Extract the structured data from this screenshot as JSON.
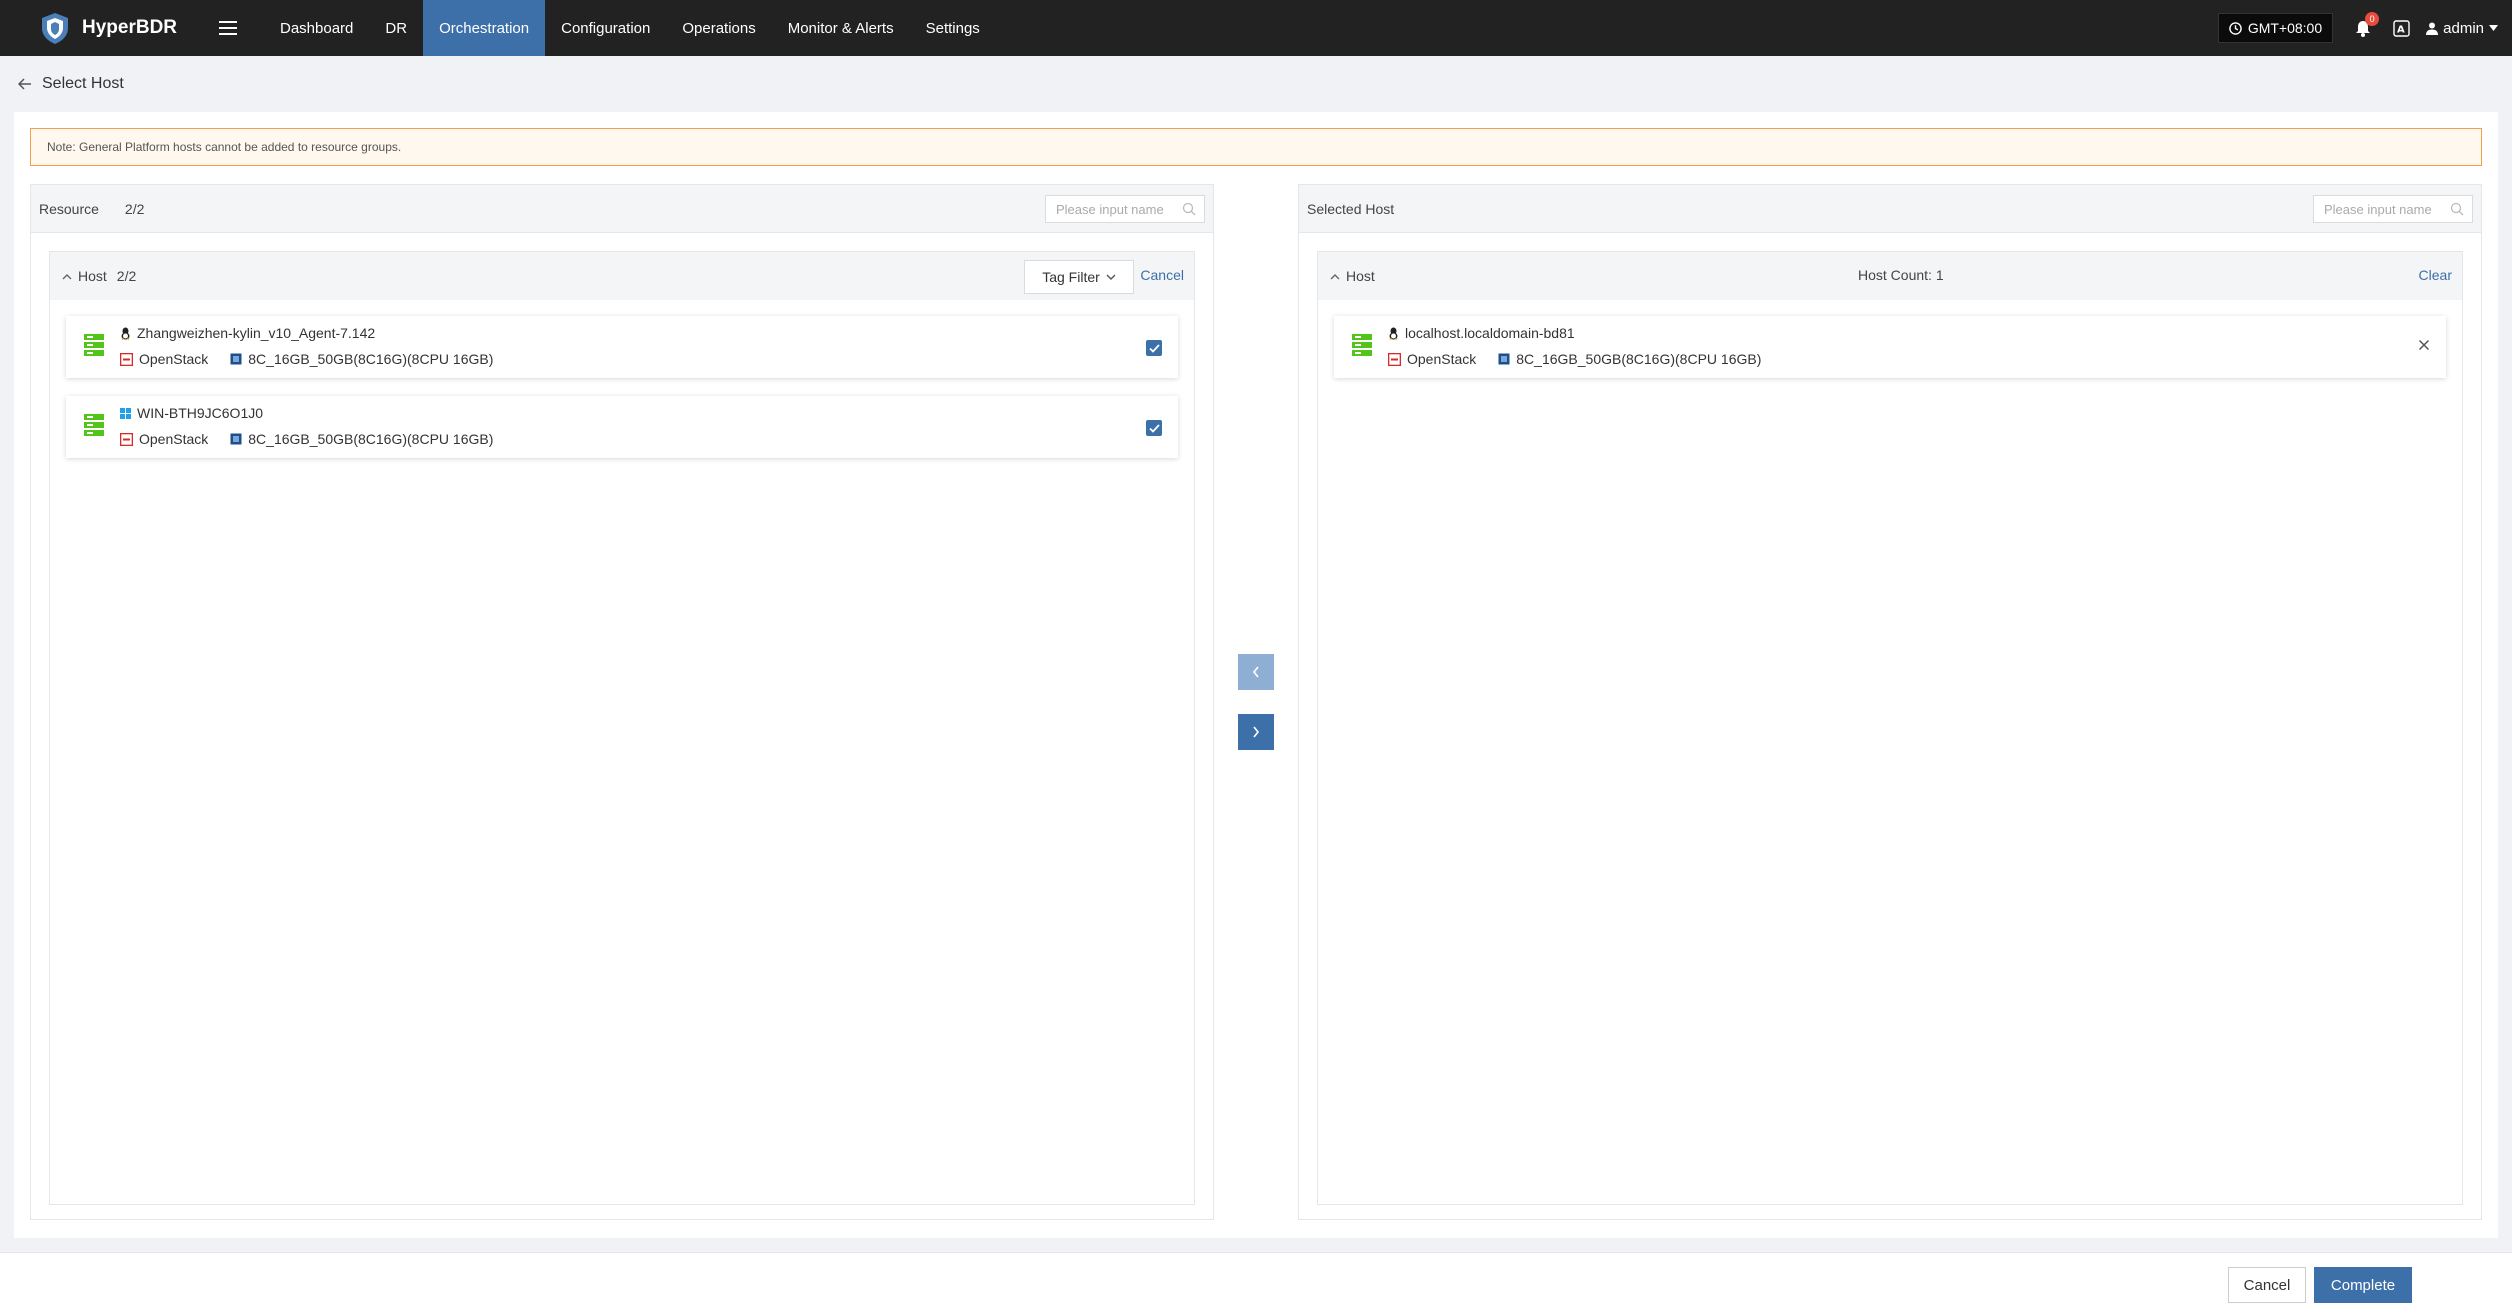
{
  "app": {
    "name": "HyperBDR"
  },
  "nav": {
    "items": [
      {
        "label": "Dashboard",
        "active": false
      },
      {
        "label": "DR",
        "active": false
      },
      {
        "label": "Orchestration",
        "active": true
      },
      {
        "label": "Configuration",
        "active": false
      },
      {
        "label": "Operations",
        "active": false
      },
      {
        "label": "Monitor & Alerts",
        "active": false
      },
      {
        "label": "Settings",
        "active": false
      }
    ],
    "timezone": "GMT+08:00",
    "notification_count": "0",
    "user": "admin"
  },
  "page": {
    "title": "Select Host",
    "note": "Note: General Platform hosts cannot be added to resource groups."
  },
  "left_panel": {
    "title": "Resource",
    "count": "2/2",
    "search_placeholder": "Please input name",
    "group": {
      "label": "Host",
      "count": "2/2",
      "tag_filter": "Tag Filter",
      "cancel": "Cancel"
    },
    "hosts": [
      {
        "name": "Zhangweizhen-kylin_v10_Agent-7.142",
        "os": "linux-icon",
        "platform": "OpenStack",
        "flavor": "8C_16GB_50GB(8C16G)(8CPU 16GB)",
        "checked": true
      },
      {
        "name": "WIN-BTH9JC6O1J0",
        "os": "windows-icon",
        "platform": "OpenStack",
        "flavor": "8C_16GB_50GB(8C16G)(8CPU 16GB)",
        "checked": true
      }
    ]
  },
  "right_panel": {
    "title": "Selected Host",
    "search_placeholder": "Please input name",
    "group": {
      "label": "Host",
      "count_text": "Host Count: 1",
      "clear": "Clear"
    },
    "hosts": [
      {
        "name": "localhost.localdomain-bd81",
        "os": "linux-icon",
        "platform": "OpenStack",
        "flavor": "8C_16GB_50GB(8C16G)(8CPU 16GB)"
      }
    ]
  },
  "footer": {
    "cancel": "Cancel",
    "complete": "Complete"
  },
  "colors": {
    "accent": "#3d6fa8",
    "nav_bg": "#222222",
    "server_icon": "#52c41a",
    "note_border": "#f0a050"
  }
}
